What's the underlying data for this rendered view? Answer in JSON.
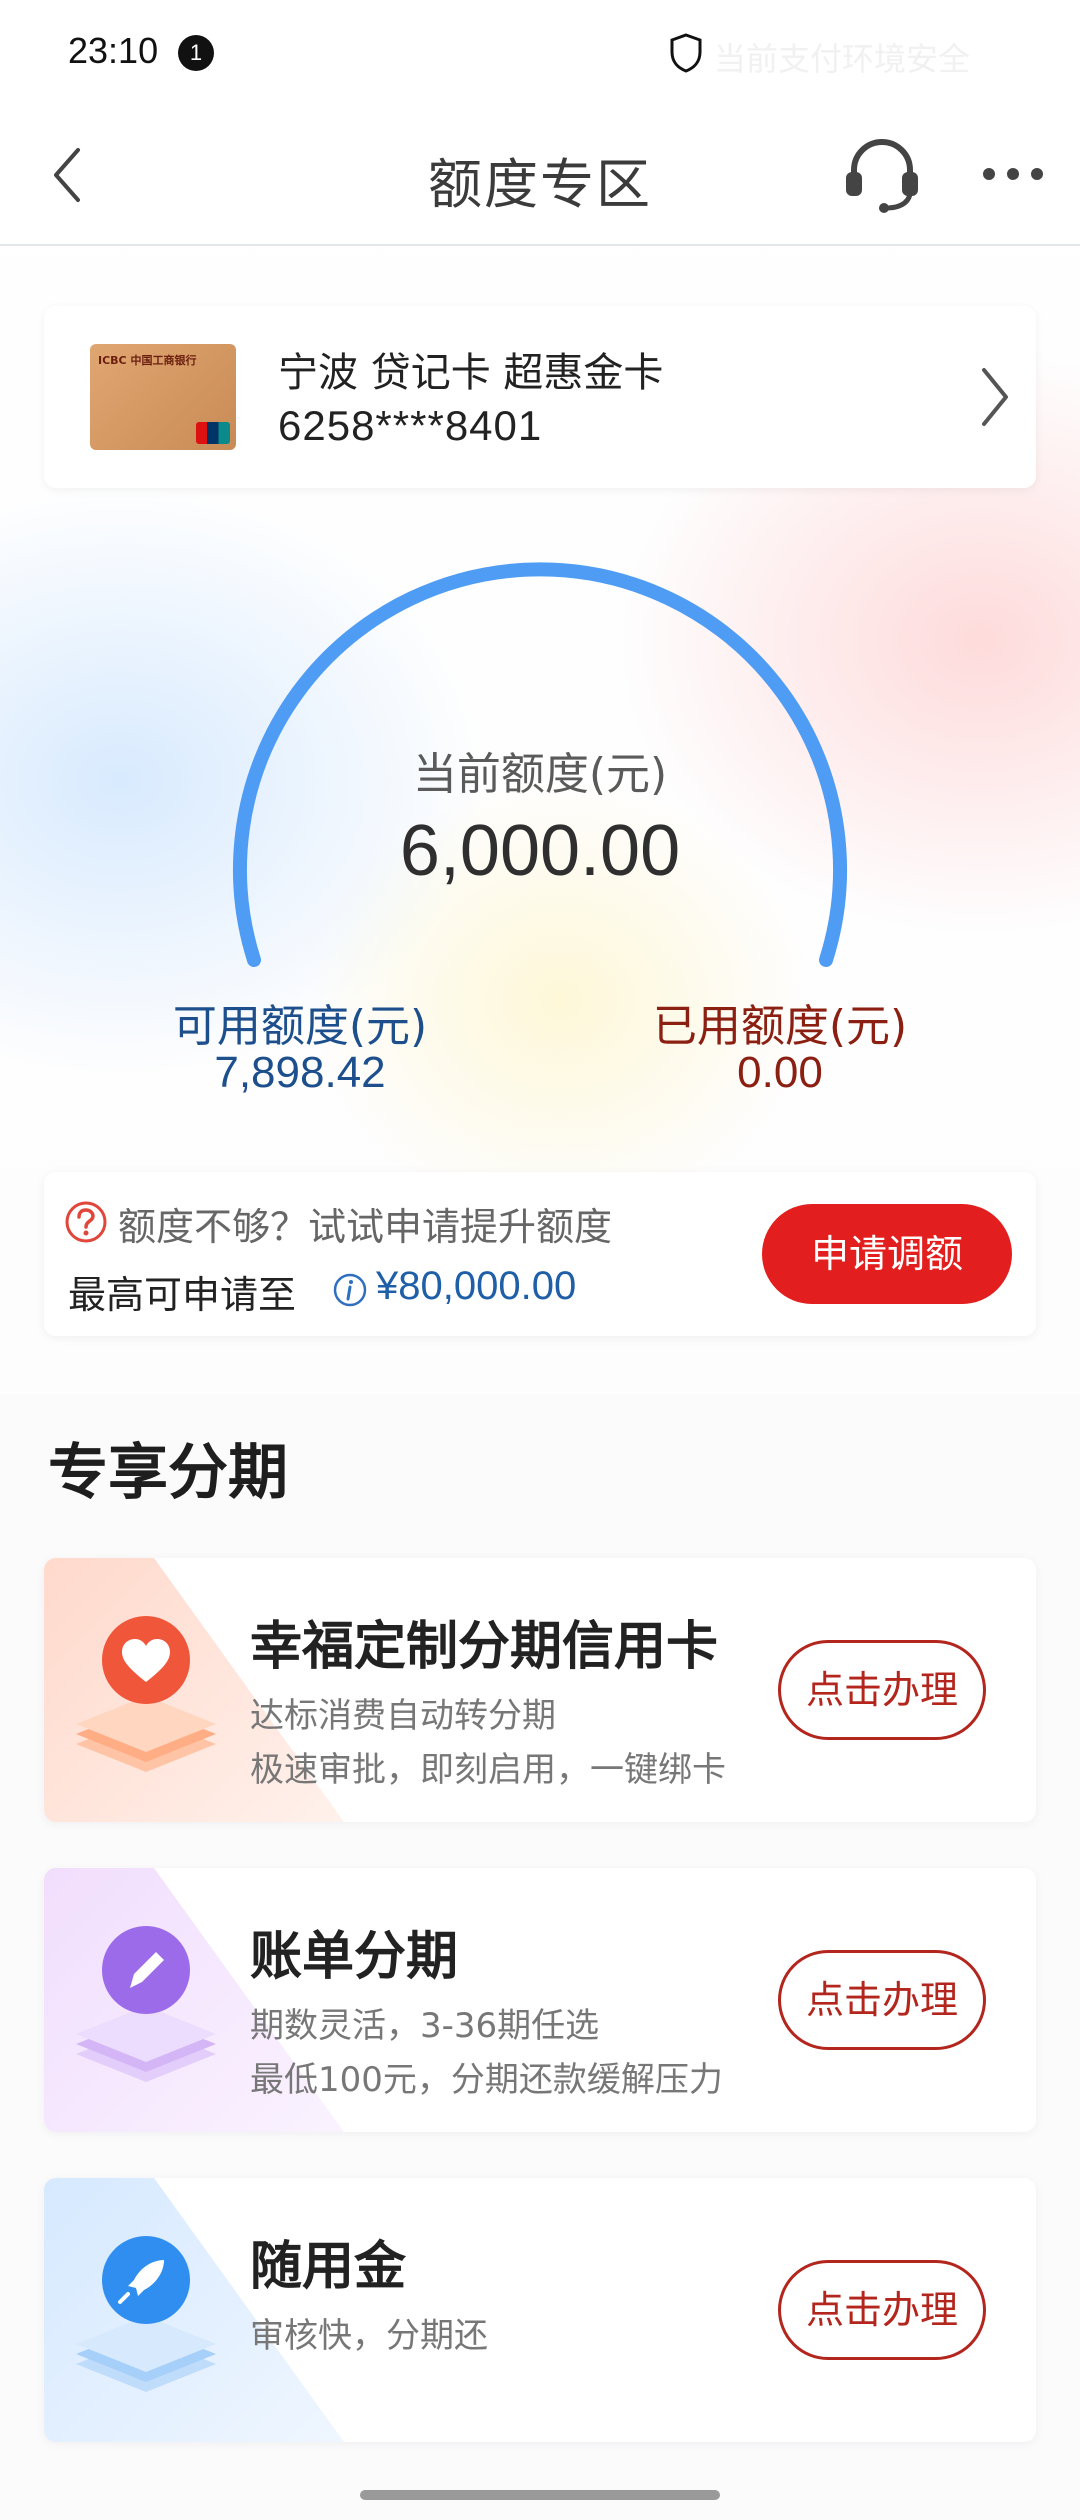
{
  "status_bar": {
    "time": "23:10",
    "notification_count": "1",
    "security_text": "当前支付环境安全"
  },
  "nav": {
    "title": "额度专区",
    "icons": [
      "back-icon",
      "headset-icon",
      "more-icon"
    ]
  },
  "card": {
    "name": "宁波 贷记卡 超惠金卡",
    "number": "6258****8401",
    "issuer_mark": "ICBC 中国工商银行"
  },
  "credit": {
    "current_label": "当前额度(元)",
    "current_value": "6,000.00",
    "available_label": "可用额度(元)",
    "available_value": "7,898.42",
    "used_label": "已用额度(元)",
    "used_value": "0.00"
  },
  "upgrade": {
    "hint": "额度不够？试试申请提升额度",
    "max_label": "最高可申请至",
    "max_value": "¥80,000.00",
    "apply_label": "申请调额"
  },
  "section": {
    "title": "专享分期"
  },
  "plans": [
    {
      "title": "幸福定制分期信用卡",
      "desc1": "达标消费自动转分期",
      "desc2": "极速审批，即刻启用，一键绑卡",
      "button": "点击办理",
      "color": "#f0563a"
    },
    {
      "title": "账单分期",
      "desc1": "期数灵活，3-36期任选",
      "desc2": "最低100元，分期还款缓解压力",
      "button": "点击办理",
      "color": "#9b6bea"
    },
    {
      "title": "随用金",
      "desc1": "审核快，分期还",
      "desc2": "",
      "button": "点击办理",
      "color": "#2f8ef0"
    }
  ],
  "colors": {
    "gauge_arc": "#4f9cf4",
    "primary_red": "#e31e1e",
    "available_blue": "#1d4f8c",
    "used_red": "#8b1f12"
  }
}
